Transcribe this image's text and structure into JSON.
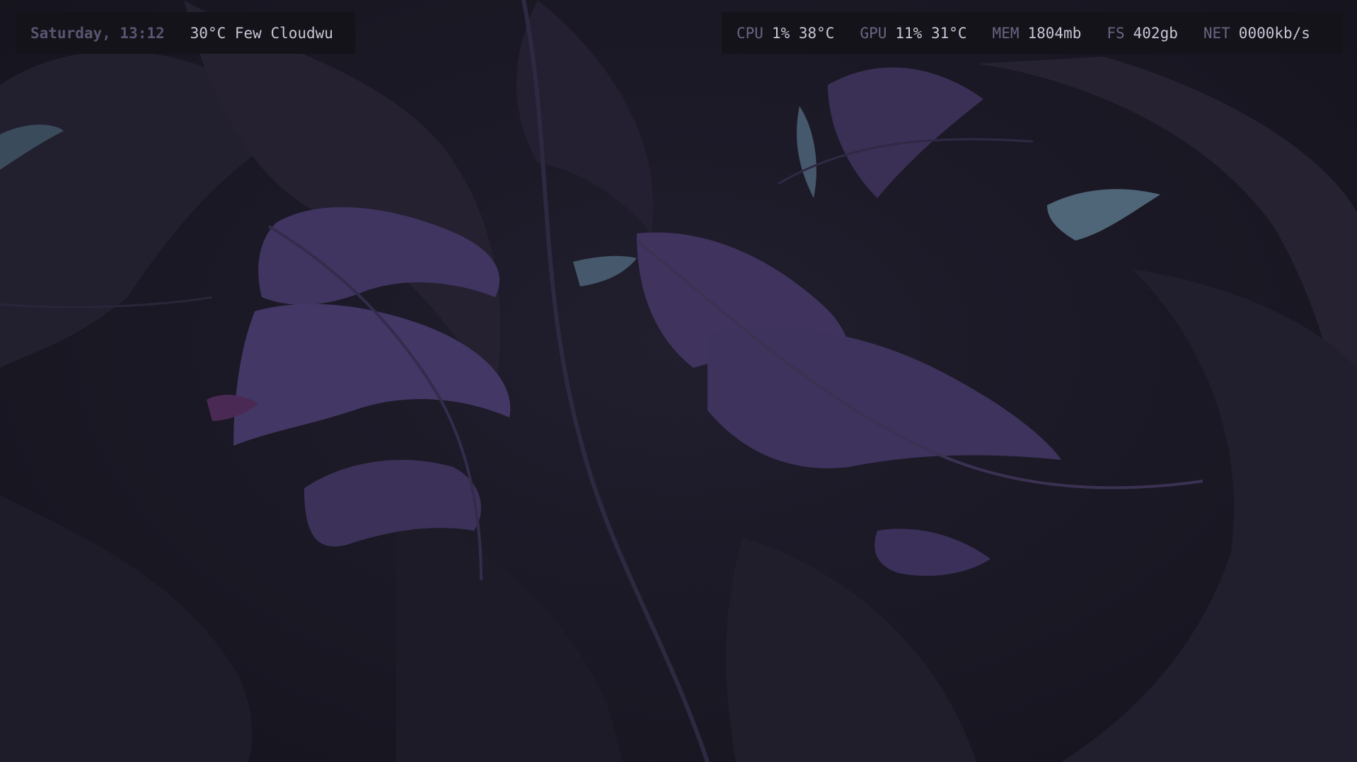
{
  "top_bar_left": {
    "datetime": "Saturday, 13:12",
    "weather": "30°C Few Cloudwu"
  },
  "top_bar_right": {
    "stats": [
      {
        "label": "CPU",
        "value": "1% 38°C"
      },
      {
        "label": "GPU",
        "value": "11% 31°C"
      },
      {
        "label": "MEM",
        "value": "1804mb"
      },
      {
        "label": "FS",
        "value": "402gb"
      },
      {
        "label": "NET",
        "value": "0000kb/s"
      }
    ]
  },
  "colors": {
    "background": "#1a1824",
    "bar_background": "#141319",
    "label_muted": "#6a6484",
    "text": "#c9c5d6",
    "leaf_purple": "#4a3d6e",
    "leaf_dark": "#2a2638",
    "leaf_teal": "#4f6578"
  }
}
